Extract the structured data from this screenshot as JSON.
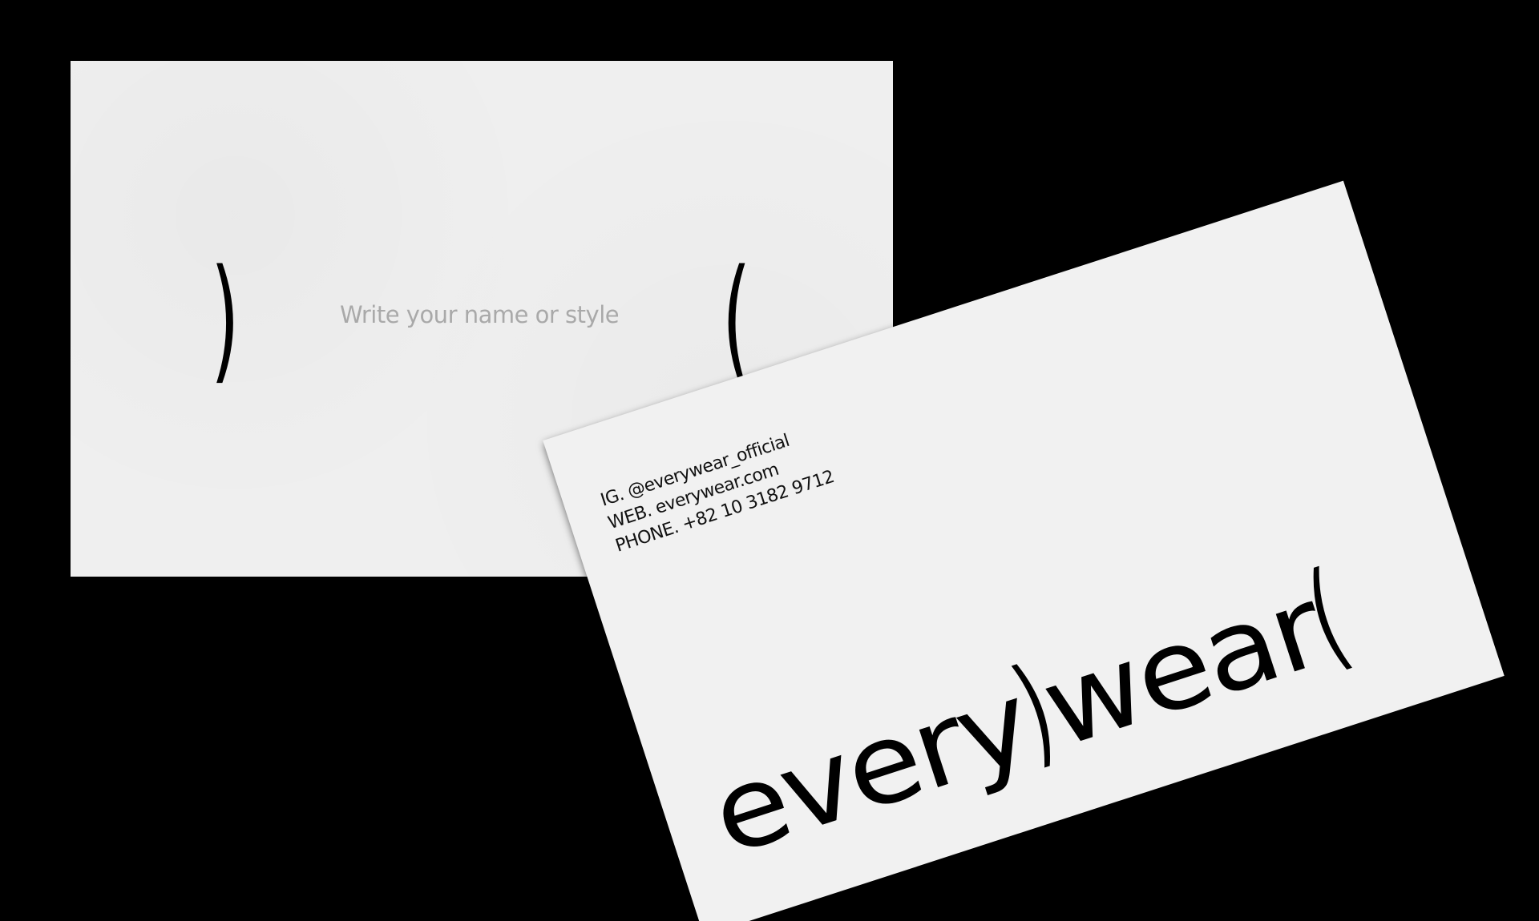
{
  "back_card": {
    "paren_right": ")",
    "paren_left": "(",
    "placeholder": "Write your name or style"
  },
  "front_card": {
    "contact": {
      "ig": "IG. @everywear_official",
      "web": "WEB. everywear.com",
      "phone": "PHONE. +82 10 3182 9712"
    },
    "wordmark": {
      "part1": "every",
      "paren1": ")",
      "part2": "wear",
      "paren2": "("
    }
  },
  "colors": {
    "background": "#000000",
    "card": "#efefef",
    "ink": "#000000",
    "placeholder": "#a9a9a9"
  }
}
